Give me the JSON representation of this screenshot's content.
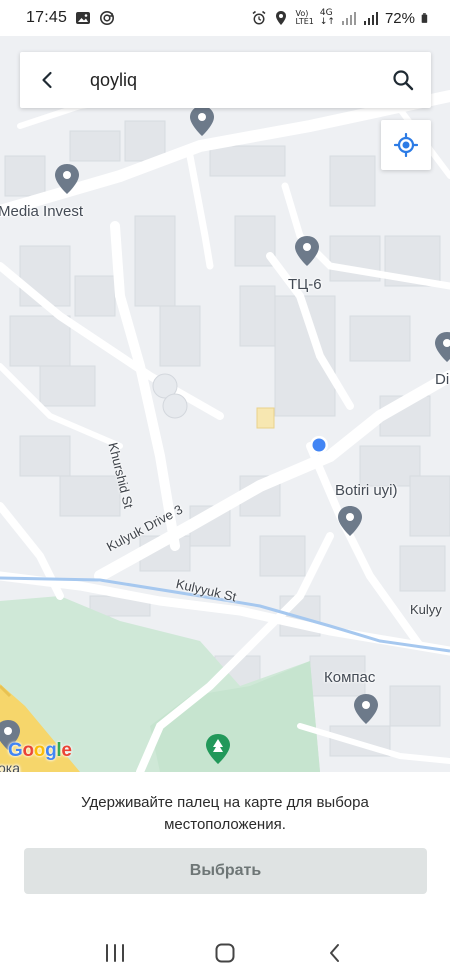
{
  "status_bar": {
    "time": "17:45",
    "network_label_top": "Vo)",
    "network_label_bottom": "LTE1",
    "network_type": "4G",
    "battery": "72%",
    "icons": [
      "gallery-icon",
      "sync-icon",
      "alarm-icon",
      "location-icon",
      "signal-icon",
      "battery-icon"
    ]
  },
  "search": {
    "query": "qoyliq",
    "back_icon": "arrow-left-icon",
    "search_icon": "magnifier-icon"
  },
  "map": {
    "locate_icon": "my-location-icon",
    "provider_logo": "Google",
    "labels": {
      "media_invest": "Media Invest",
      "tc6": "ТЦ-6",
      "di": "Di",
      "botiri": "Botiri uyi)",
      "khurshid": "Khurshid St",
      "kulyuk_drive": "Kulyuk Drive 3",
      "kulyyuk_st": "Kulyyuk St",
      "kulyy_right": "Kulyy",
      "kompas": "Компас",
      "partial_bottom": "ока"
    }
  },
  "bottom_sheet": {
    "hint": "Удерживайте палец на карте для выбора местоположения.",
    "select_button": "Выбрать"
  },
  "nav": {
    "recents": "recents-icon",
    "home": "home-icon",
    "back": "back-icon"
  }
}
